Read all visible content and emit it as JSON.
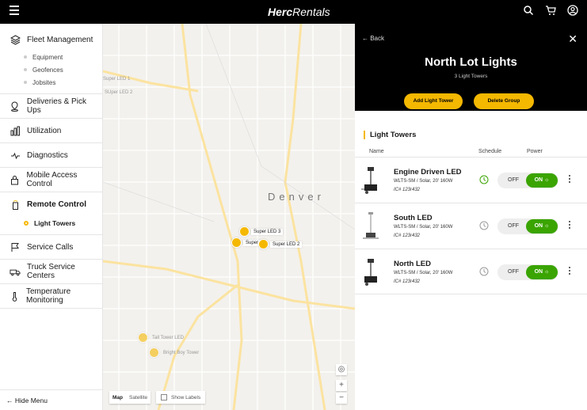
{
  "topbar": {
    "brand_bold": "Herc",
    "brand_rest": "Rentals"
  },
  "sidebar": {
    "fleet": "Fleet Management",
    "fleet_subs": [
      "Equipment",
      "Geofences",
      "Jobsites"
    ],
    "deliveries": "Deliveries & Pick Ups",
    "utilization": "Utilization",
    "diagnostics": "Diagnostics",
    "mobile": "Mobile Access Control",
    "remote": "Remote Control",
    "remote_sub": "Light Towers",
    "service": "Service Calls",
    "truck": "Truck Service Centers",
    "temperature": "Temperature Monitoring",
    "hide_menu": "← Hide Menu"
  },
  "map": {
    "city": "Denver",
    "left_labels": [
      "Super LED 1",
      "SUper LED 2"
    ],
    "markers": [
      "Super LED 3",
      "Super",
      "Super LED 2",
      "Tall Tower LED",
      "Bright Boy Tower"
    ],
    "map_btn": "Map",
    "satellite_btn": "Satellite",
    "show_labels": "Show Labels",
    "zoom_in": "+",
    "zoom_out": "−"
  },
  "panel": {
    "back": "← Back",
    "title": "North Lot Lights",
    "subtitle": "3 Light Towers",
    "add_btn": "Add Light Tower",
    "delete_btn": "Delete Group",
    "section": "Light Towers",
    "col_name": "Name",
    "col_schedule": "Schedule",
    "col_power": "Power",
    "rows": [
      {
        "name": "Engine Driven LED",
        "spec": "WLTS-SM / Solar, 20' 160W",
        "id": "IC# 123r432",
        "off": "OFF",
        "on": "ON ☼"
      },
      {
        "name": "South LED",
        "spec": "WLTS-SM / Solar, 20' 160W",
        "id": "IC# 123r432",
        "off": "OFF",
        "on": "ON ☼"
      },
      {
        "name": "North LED",
        "spec": "WLTS-SM / Solar, 20' 160W",
        "id": "IC# 123r432",
        "off": "OFF",
        "on": "ON ☼"
      }
    ]
  },
  "colors": {
    "accent": "#f5b800",
    "on_green": "#3aa400",
    "header_black": "#000000"
  }
}
